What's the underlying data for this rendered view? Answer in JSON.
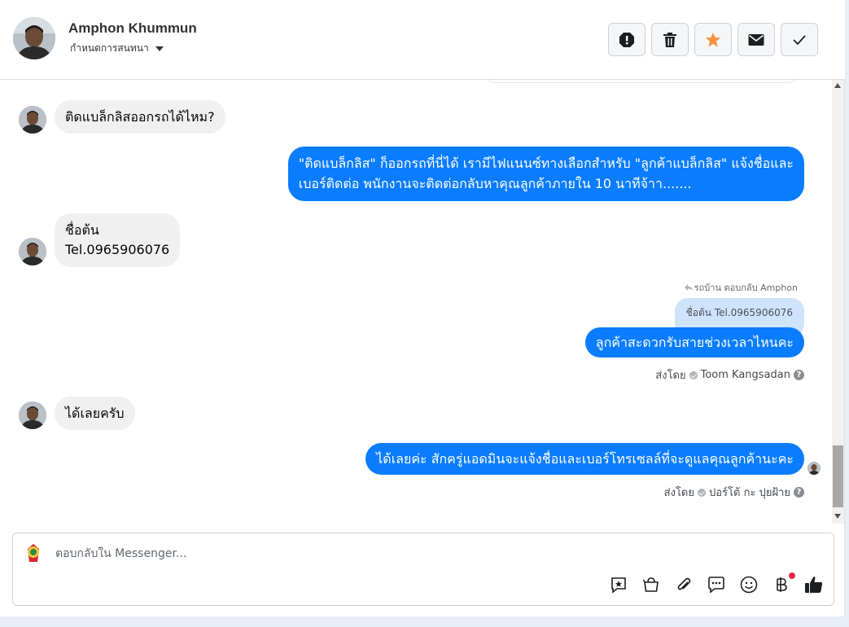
{
  "header": {
    "name": "Amphon Khummun",
    "subtitle": "กำหนดการสนทนา",
    "toolbar": [
      {
        "name": "spam-icon",
        "color": "#1c1e21"
      },
      {
        "name": "trash-icon",
        "color": "#1c1e21"
      },
      {
        "name": "star-icon",
        "color": "#f7923a"
      },
      {
        "name": "mail-icon",
        "color": "#1c1e21"
      },
      {
        "name": "check-icon",
        "color": "#1c1e21"
      }
    ]
  },
  "messages": {
    "m1": "ติดแบล็กลิสออกรถได้ไหม?",
    "m2_line1": "\"ติดแบล็กลิส\" ก็ออกรถที่นี่ได้ เรามีไฟแนนซ์ทางเลือกสำหรับ \"ลูกค้าแบล็กลิส\" แจ้งชื่อและ",
    "m2_line2": "เบอร์ติดต่อ พนักงานจะติดต่อกลับหาคุณลูกค้าภายใน 10 นาทีจ้าา.......",
    "m3_line1": "ชื่อต้น",
    "m3_line2": "Tel.0965906076",
    "reply_note": "รถบ้าน ตอบกลับ Amphon",
    "quoted": "ชื่อต้น Tel.0965906076",
    "m4": "ลูกค้าสะดวกรับสายช่วงเวลาไหนคะ",
    "m4_sent_prefix": "ส่งโดย",
    "m4_sent_by": "Toom Kangsadan",
    "m5": "ได้เลยครับ",
    "m6": "ได้เลยค่ะ สักครู่แอดมินจะแจ้งชื่อและเบอร์โทรเซลล์ที่จะดูแลคุณลูกค้านะคะ",
    "m6_sent_prefix": "ส่งโดย",
    "m6_sent_by": "ปอร์โต้ กะ ปุยฝ้าย"
  },
  "composer": {
    "placeholder": "ตอบกลับใน Messenger...",
    "icons": [
      "saved-reply-icon",
      "shop-icon",
      "attach-icon",
      "chat-icon",
      "emoji-icon",
      "baht-icon",
      "like-icon"
    ]
  },
  "colors": {
    "outgoing_bubble": "#0a7cff",
    "incoming_bubble": "#f0f0f0",
    "quoted_bubble": "#cfe3fd"
  }
}
